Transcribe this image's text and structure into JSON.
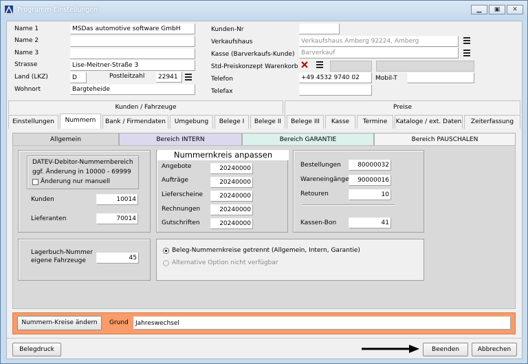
{
  "window": {
    "title": "Programm-Einstellungen",
    "controls": [
      "▁",
      "▣",
      "✕"
    ]
  },
  "form": {
    "left_labels": [
      "Name 1",
      "Name 2",
      "Name 3",
      "Strasse",
      "Land (LKZ)",
      "Postleitzahl",
      "Wohnort"
    ],
    "name1": "MSDas automotive software GmbH",
    "name2": "",
    "name3": "",
    "strasse": "Lise-Meitner-Straße 3",
    "land": "D",
    "plz": "22941",
    "wohnort": "Bargteheide",
    "right_labels": [
      "Kunden-Nr",
      "Verkaufshaus",
      "Kasse (Barverkaufs-Kunde)",
      "Std-Preiskonzept Warenkorb",
      "Telefon",
      "Telefax",
      "Mobil-T"
    ],
    "kunden_nr": "",
    "verkaufshaus": "Verkaufshaus Amberg 92224, Amberg",
    "kasse": "Barverkauf",
    "preiskonzept": "",
    "telefon": "+49 4532 9740 02",
    "telefax": "",
    "mobil": ""
  },
  "tab_groups": [
    "Kunden / Fahrzeuge",
    "Preise"
  ],
  "tabs": [
    "Einstellungen",
    "Nummern",
    "Bank / Firmendaten",
    "Umgebung",
    "Belege I",
    "Belege II",
    "Belege III",
    "Kasse",
    "Termine",
    "Kataloge / ext. Daten",
    "Zeiterfassung"
  ],
  "subtabs": [
    "Allgemein",
    "Bereich INTERN",
    "Bereich GARANTIE",
    "Bereich PAUSCHALEN"
  ],
  "datev": {
    "line1": "DATEV-Debitor-Nummernbereich",
    "line2": "ggf. Änderung in 10000 - 69999",
    "check_label": "Änderung nur manuell"
  },
  "kunden": {
    "label": "Kunden",
    "value": "10014"
  },
  "lieferanten": {
    "label": "Lieferanten",
    "value": "70014"
  },
  "nummernkreis": {
    "title": "Nummernkreis anpassen",
    "rows": [
      {
        "label": "Angebote",
        "value": "20240000"
      },
      {
        "label": "Aufträge",
        "value": "20240000"
      },
      {
        "label": "Lieferscheine",
        "value": "20240000"
      },
      {
        "label": "Rechnungen",
        "value": "20240000"
      },
      {
        "label": "Gutschriften",
        "value": "20240000"
      }
    ]
  },
  "right_box": {
    "rows": [
      {
        "label": "Bestellungen",
        "value": "80000032"
      },
      {
        "label": "Wareneingänge",
        "value": "90000016"
      },
      {
        "label": "Retouren",
        "value": "10"
      }
    ],
    "kassen_label": "Kassen-Bon",
    "kassen_value": "41"
  },
  "lagerbuch": {
    "line1": "Lagerbuch-Nummer",
    "line2": "eigene Fahrzeuge",
    "value": "45"
  },
  "radios": {
    "opt1": "Beleg-Nummernkreise getrennt (Allgemein, Intern, Garantie)",
    "opt2": "Alternative Option nicht verfügbar"
  },
  "change_bar": {
    "button": "Nummern-Kreise ändern",
    "grund_label": "Grund",
    "grund_value": "Jahreswechsel",
    "color": "#f79c6a"
  },
  "bottom": {
    "belegdruck": "Belegdruck",
    "beenden": "Beenden",
    "abbrechen": "Abbrechen"
  }
}
